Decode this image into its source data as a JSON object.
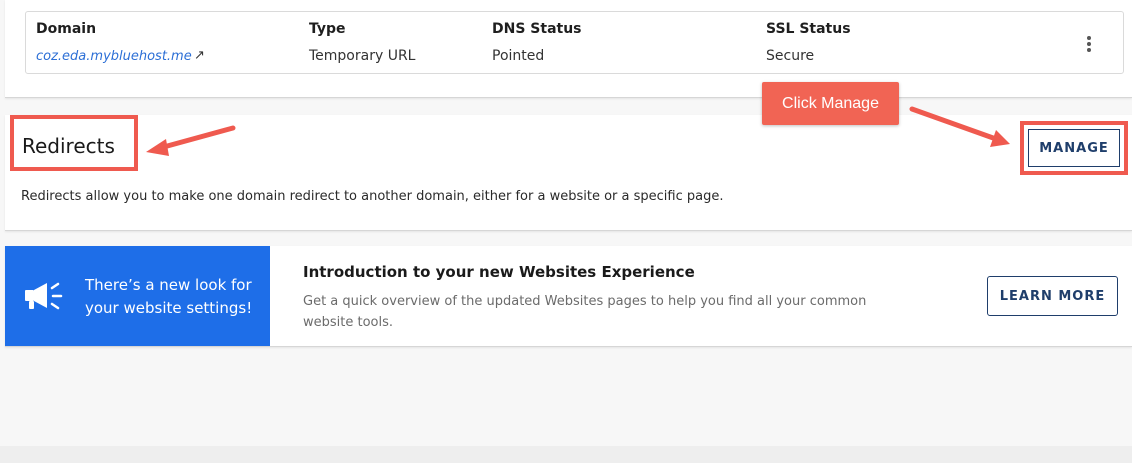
{
  "domains_table": {
    "headers": [
      "Domain",
      "Type",
      "DNS Status",
      "SSL Status"
    ],
    "row": {
      "domain": "coz.eda.mybluehost.me",
      "external_icon": "external-link-icon",
      "type": "Temporary URL",
      "dns_status": "Pointed",
      "ssl_status": "Secure",
      "menu_icon": "kebab-menu-icon"
    }
  },
  "redirects": {
    "title": "Redirects",
    "description": "Redirects allow you to make one domain redirect to another domain, either for a website or a specific page.",
    "manage_label": "MANAGE"
  },
  "annotation": {
    "callout_text": "Click Manage",
    "highlight_color": "#ef5a4f"
  },
  "promo": {
    "icon": "megaphone-icon",
    "banner_text": "There’s a new look for your website settings!",
    "title": "Introduction to your new Websites Experience",
    "description": "Get a quick overview of the updated Websites pages to help you find all your common website tools.",
    "button_label": "LEARN MORE",
    "banner_color": "#1e6ee8"
  }
}
